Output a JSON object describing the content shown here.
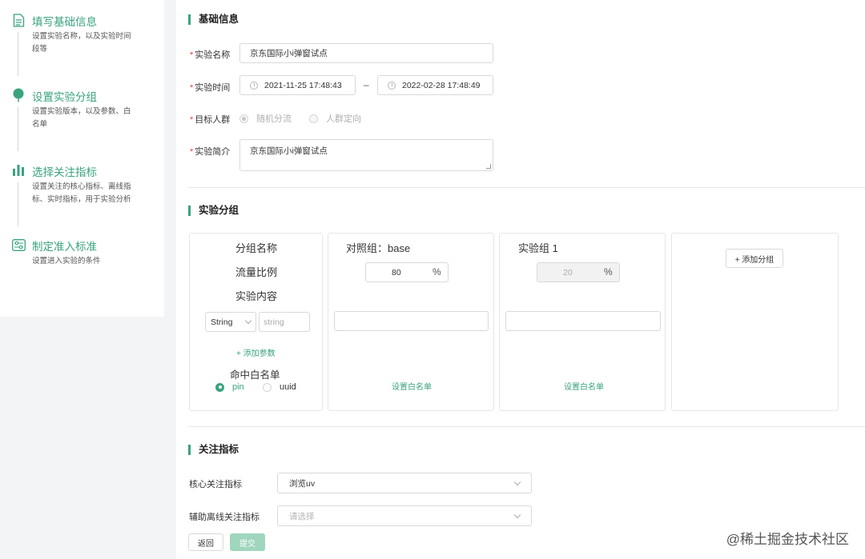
{
  "sidebar": {
    "steps": [
      {
        "icon": "document-icon",
        "title": "填写基础信息",
        "desc": "设置实验名称，以及实验时间段等"
      },
      {
        "icon": "balloon-icon",
        "title": "设置实验分组",
        "desc": "设置实验版本，以及参数、白名单"
      },
      {
        "icon": "bar-chart-icon",
        "title": "选择关注指标",
        "desc": "设置关注的核心指标、离线指标、实时指标，用于实验分析"
      },
      {
        "icon": "settings-panel-icon",
        "title": "制定准入标准",
        "desc": "设置进入实验的条件"
      }
    ],
    "accent": "#3aa37e"
  },
  "basic": {
    "section_title": "基础信息",
    "name_label": "实验名称",
    "name_value": "京东国际小i弹窗试点",
    "time_label": "实验时间",
    "start_time": "2021-11-25 17:48:43",
    "end_time": "2022-02-28 17:48:49",
    "dash": "–",
    "audience_label": "目标人群",
    "audience_options": [
      "随机分流",
      "人群定向"
    ],
    "intro_label": "实验简介",
    "intro_value": "京东国际小i弹窗试点",
    "required_mark": "*"
  },
  "groups": {
    "section_title": "实验分组",
    "row_labels": [
      "分组名称",
      "流量比例",
      "实验内容"
    ],
    "param_type": "String",
    "param_key": "string",
    "add_param": "+ 添加参数",
    "whitelist_label": "命中白名单",
    "whitelist_options": [
      "pin",
      "uuid"
    ],
    "control": {
      "name": "对照组：base",
      "ratio": "80",
      "unit": "%",
      "whitelist_link": "设置白名单"
    },
    "experiment": {
      "name": "实验组 1",
      "ratio": "20",
      "unit": "%",
      "whitelist_link": "设置白名单"
    },
    "add_group": "+ 添加分组"
  },
  "metrics": {
    "section_title": "关注指标",
    "core_label": "核心关注指标",
    "core_value": "浏览uv",
    "offline_label": "辅助离线关注指标",
    "offline_placeholder": "请选择"
  },
  "actions": {
    "back": "返回",
    "submit": "提交"
  },
  "watermark": "@稀土掘金技术社区"
}
